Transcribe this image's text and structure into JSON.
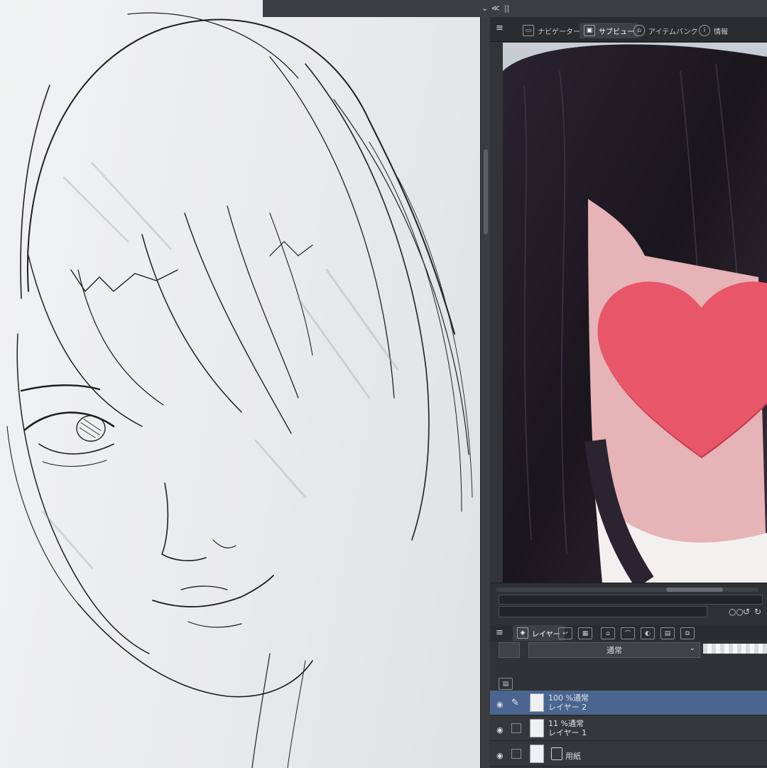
{
  "window": {
    "collapse_glyph": "≪",
    "chevron": "⌄",
    "grip": "||"
  },
  "panel": {
    "menu_icon": "≡",
    "tabs": [
      {
        "label": "ナビゲーター",
        "icon": "navigator-icon",
        "active": false
      },
      {
        "label": "サブビュー",
        "icon": "subview-icon",
        "active": true
      },
      {
        "label": "アイテムバンク",
        "icon": "item-bank-icon",
        "active": false
      },
      {
        "label": "情報",
        "icon": "info-icon",
        "active": false
      }
    ],
    "subview_controls": {
      "zoom_glyphs": "○○",
      "rotate_left": "↺",
      "rotate_right": "↻"
    }
  },
  "layer_palette": {
    "menu_icon": "≡",
    "tab_label": "レイヤー",
    "blend_mode": "通常",
    "layers": [
      {
        "meta": "100 %通常",
        "name": "レイヤー 2",
        "selected": true,
        "editing": true
      },
      {
        "meta": "11 %通常",
        "name": "レイヤー 1",
        "selected": false,
        "editing": false
      },
      {
        "meta": "",
        "name": "用紙",
        "selected": false,
        "editing": false,
        "paper": true
      }
    ]
  },
  "colors": {
    "panel_bg": "#323437",
    "selected_layer": "#4a6690",
    "heart": "#e8566a",
    "heart_shadow": "#c8394e",
    "sketch_line": "#1f1f22"
  }
}
